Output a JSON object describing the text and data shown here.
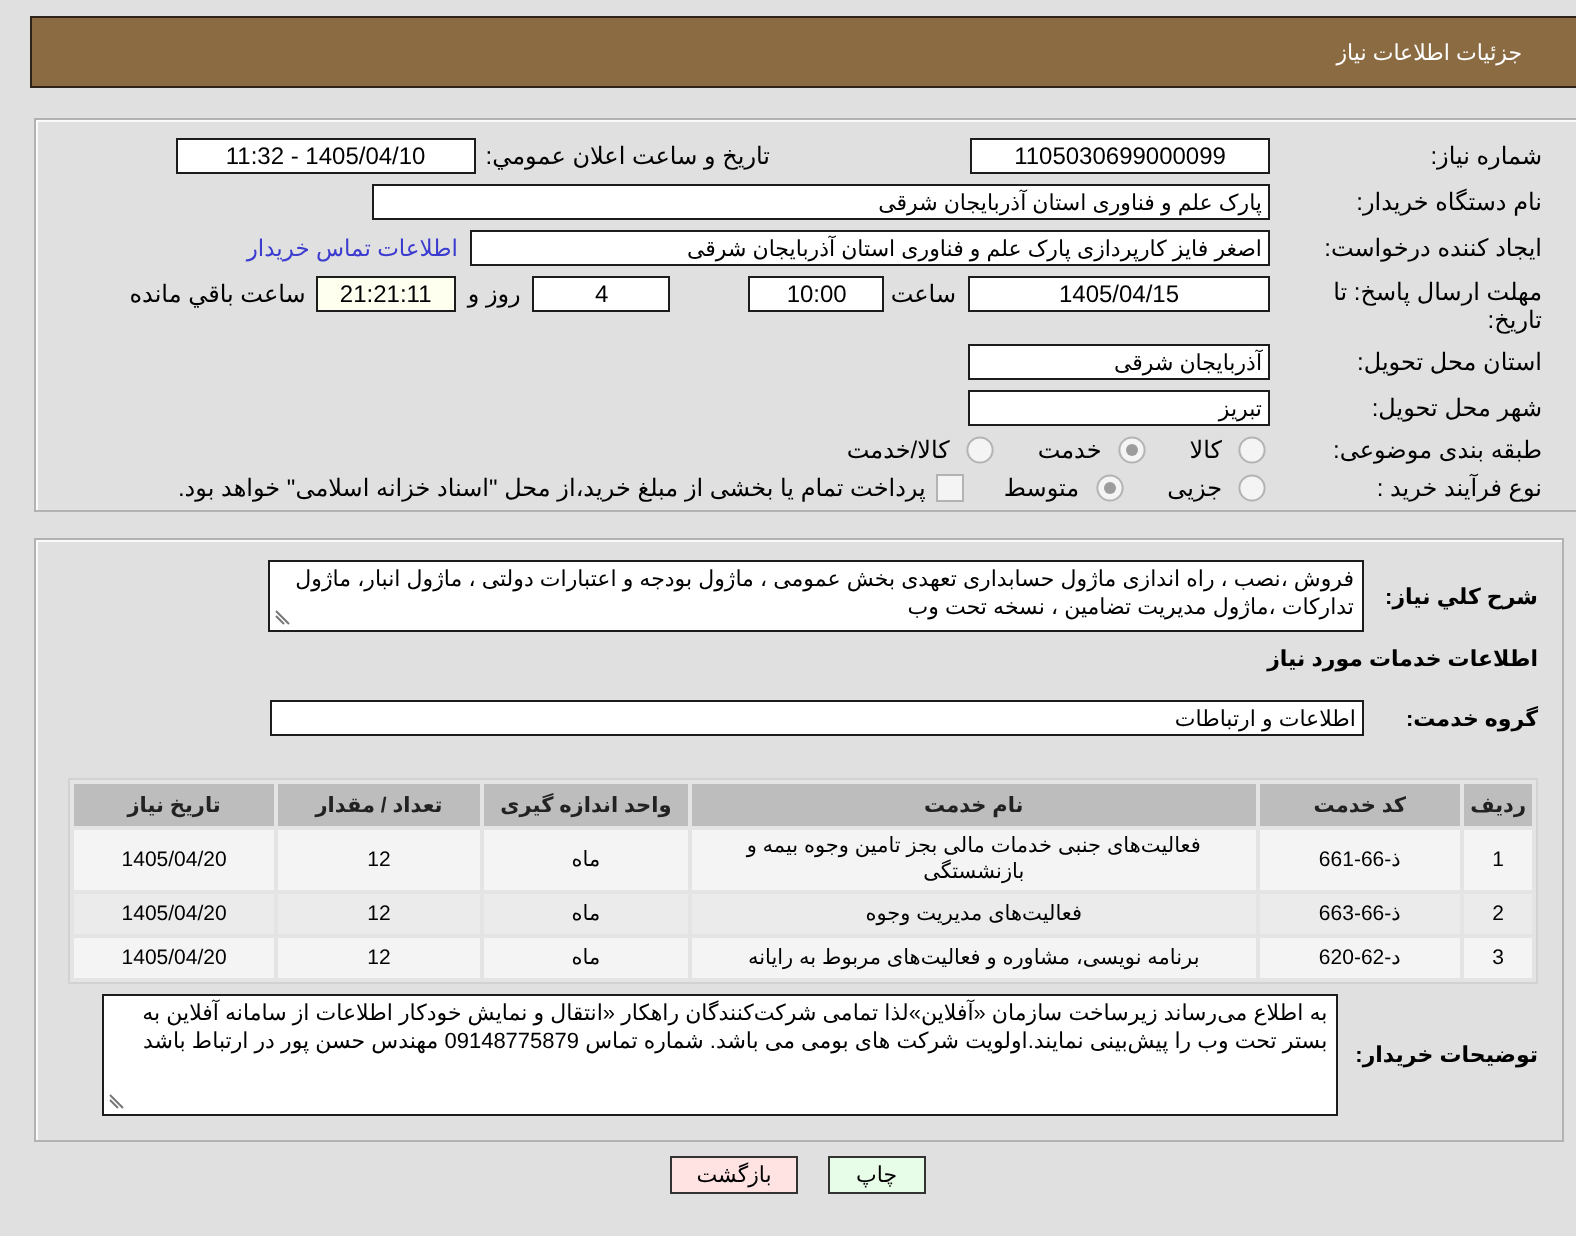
{
  "header": {
    "title": "جزئیات اطلاعات نیاز"
  },
  "details": {
    "need_number": {
      "label": "شماره نیاز:",
      "value": "1105030699000099"
    },
    "announcement": {
      "label": "تاریخ و ساعت اعلان عمومي:",
      "value": "1405/04/10 - 11:32"
    },
    "buyer": {
      "label": "نام دستگاه خریدار:",
      "value": "پارک علم و فناوری استان آذربایجان شرقی"
    },
    "requester": {
      "label": "ایجاد کننده درخواست:",
      "value": "اصغر فایز کارپردازی پارک علم و فناوری استان آذربایجان شرقی",
      "contact_link": "اطلاعات تماس خریدار"
    },
    "deadline": {
      "label": "مهلت ارسال پاسخ: تا تاریخ:",
      "date": "1405/04/15",
      "time_label": "ساعت",
      "time": "10:00",
      "days": "4",
      "days_label": "روز و",
      "remaining": "21:21:11",
      "remaining_label": "ساعت باقي مانده"
    },
    "province": {
      "label": "استان محل تحویل:",
      "value": "آذربایجان شرقی"
    },
    "city": {
      "label": "شهر محل تحویل:",
      "value": "تبریز"
    },
    "category": {
      "label": "طبقه بندی موضوعی:",
      "options": [
        {
          "label": "کالا",
          "selected": false
        },
        {
          "label": "خدمت",
          "selected": true
        },
        {
          "label": "کالا/خدمت",
          "selected": false
        }
      ]
    },
    "process": {
      "label": "نوع فرآیند خرید :",
      "options": [
        {
          "label": "جزیی",
          "selected": false
        },
        {
          "label": "متوسط",
          "selected": true
        }
      ],
      "treasury": {
        "label": "پرداخت تمام یا بخشی از مبلغ خرید،از محل \"اسناد خزانه اسلامی\" خواهد بود.",
        "checked": false
      }
    }
  },
  "services": {
    "description": {
      "label": "شرح کلي نیاز:",
      "value": "فروش ،نصب ، راه اندازی ماژول حسابداری تعهدی بخش عمومی ، ماژول بودجه و اعتبارات دولتی ، ماژول انبار، ماژول تدارکات ،ماژول مدیریت تضامین ، نسخه تحت وب"
    },
    "section_title": "اطلاعات خدمات مورد نیاز",
    "group": {
      "label": "گروه خدمت:",
      "value": "اطلاعات و ارتباطات"
    },
    "table": {
      "columns": [
        "ردیف",
        "کد خدمت",
        "نام خدمت",
        "واحد اندازه گیری",
        "تعداد / مقدار",
        "تاریخ نیاز"
      ],
      "rows": [
        [
          "1",
          "ذ-66-661",
          "فعالیت‌های جنبی خدمات مالی بجز تامین وجوه بیمه و بازنشستگی",
          "ماه",
          "12",
          "1405/04/20"
        ],
        [
          "2",
          "ذ-66-663",
          "فعالیت‌های مدیریت وجوه",
          "ماه",
          "12",
          "1405/04/20"
        ],
        [
          "3",
          "د-62-620",
          "برنامه نویسی، مشاوره و فعالیت‌های مربوط به رایانه",
          "ماه",
          "12",
          "1405/04/20"
        ]
      ]
    },
    "buyer_notes": {
      "label": "توضیحات خریدار:",
      "value": "به اطلاع می‌رساند زیرساخت سازمان «آفلاین»لذا تمامی شرکت‌کنندگان راهکار «انتقال و نمایش خودکار اطلاعات از سامانه آفلاین به بستر تحت وب را پیش‌بینی نمایند.اولویت شرکت های بومی می باشد. شماره تماس 09148775879 مهندس حسن پور در ارتباط باشد"
    }
  },
  "buttons": [
    {
      "label": "چاپ",
      "kind": "print"
    },
    {
      "label": "بازگشت",
      "kind": "back"
    }
  ]
}
